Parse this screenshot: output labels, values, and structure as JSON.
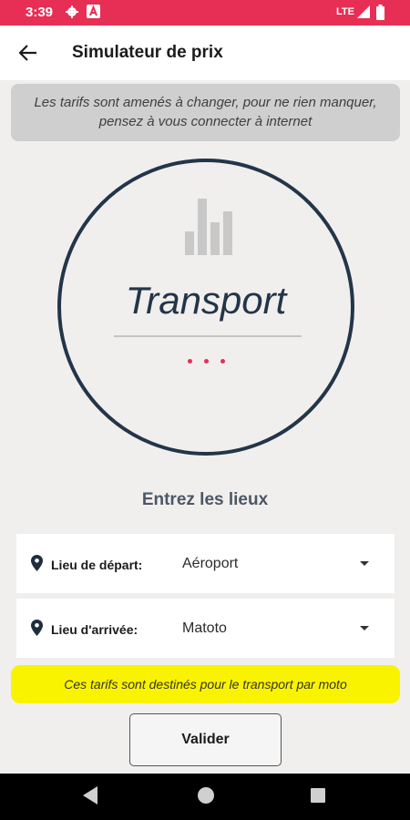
{
  "status_bar": {
    "time": "3:39",
    "network": "LTE",
    "icons": [
      "gear-icon",
      "a-app-icon",
      "signal-icon",
      "battery-icon"
    ],
    "color": "#e72f55"
  },
  "app_bar": {
    "back_icon": "arrow-left-icon",
    "title": "Simulateur de prix"
  },
  "notice": {
    "text": "Les tarifs sont amenés à changer, pour ne rien manquer, pensez à vous connecter à internet"
  },
  "circle": {
    "icon": "bar-chart-icon",
    "title": "Transport",
    "dots": [
      "dot",
      "dot",
      "dot"
    ],
    "border_color": "#233548",
    "accent": "#e72f55"
  },
  "form": {
    "heading": "Entrez les lieux",
    "fields": [
      {
        "icon": "location-pin-icon",
        "label": "Lieu de départ:",
        "value": "Aéroport"
      },
      {
        "icon": "location-pin-icon",
        "label": "Lieu d'arrivée:",
        "value": "Matoto"
      }
    ]
  },
  "yellow_notice": {
    "text": "Ces tarifs sont destinés pour le transport par moto",
    "color": "#f9f300"
  },
  "validate_button": {
    "label": "Valider"
  },
  "nav_bar": {
    "icons": [
      "back-triangle-icon",
      "home-circle-icon",
      "recents-square-icon"
    ]
  }
}
